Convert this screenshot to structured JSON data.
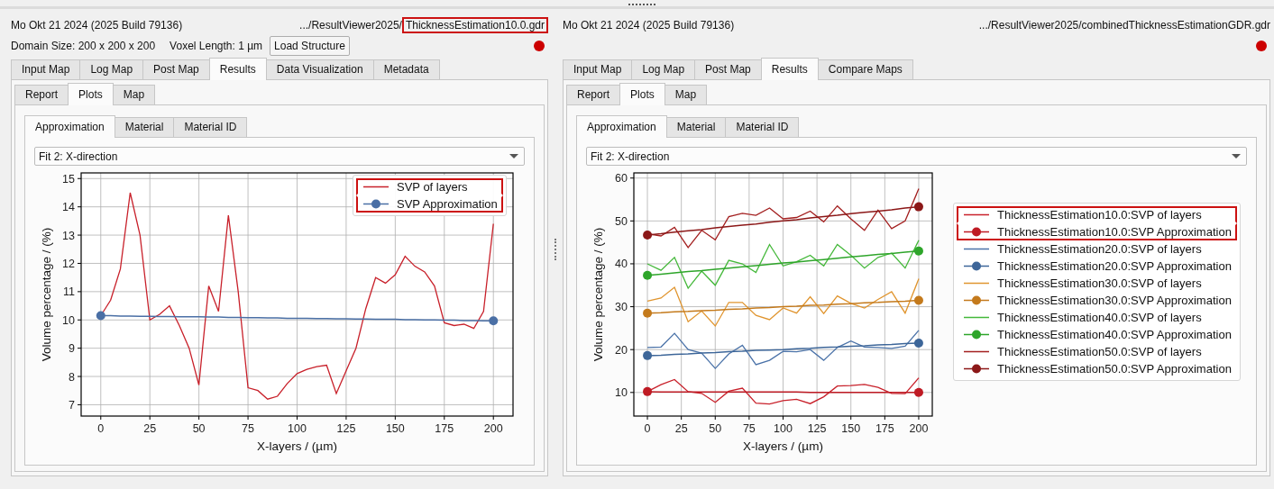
{
  "panes": [
    {
      "date": "Mo Okt 21 2024 (2025 Build 79136)",
      "path": ".../ResultViewer2025/",
      "file": "ThicknessEstimation10.0.gdr",
      "file_highlighted": true,
      "domain_size": "Domain Size: 200 x 200 x 200",
      "voxel_length": "Voxel Length: 1 µm",
      "load_button": "Load Structure",
      "tabs": [
        {
          "label": "Input Map",
          "selected": false
        },
        {
          "label": "Log Map",
          "selected": false
        },
        {
          "label": "Post Map",
          "selected": false
        },
        {
          "label": "Results",
          "selected": true
        },
        {
          "label": "Data Visualization",
          "selected": false
        },
        {
          "label": "Metadata",
          "selected": false
        }
      ],
      "subtabs": [
        {
          "label": "Report",
          "selected": false
        },
        {
          "label": "Plots",
          "selected": true
        },
        {
          "label": "Map",
          "selected": false
        }
      ],
      "plot_tabs": [
        {
          "label": "Approximation",
          "selected": true
        },
        {
          "label": "Material",
          "selected": false
        },
        {
          "label": "Material ID",
          "selected": false
        }
      ],
      "fit_select": "Fit 2: X-direction",
      "legend_entries": [
        {
          "highlighted": true,
          "marker": false
        },
        {
          "highlighted": true,
          "marker": true
        }
      ],
      "chart_data": {
        "type": "line",
        "xlabel": "X-layers / (µm)",
        "ylabel": "Volume percentage / (%)",
        "xlim": [
          -10,
          210
        ],
        "ylim": [
          6.6,
          15.2
        ],
        "xticks": [
          0,
          25,
          50,
          75,
          100,
          125,
          150,
          175,
          200
        ],
        "yticks": [
          7,
          8,
          9,
          10,
          11,
          12,
          13,
          14,
          15
        ],
        "grid": true,
        "legend": "upper right",
        "x": [
          0,
          5,
          10,
          15,
          20,
          25,
          30,
          35,
          40,
          45,
          50,
          55,
          60,
          65,
          70,
          75,
          80,
          85,
          90,
          95,
          100,
          105,
          110,
          115,
          120,
          125,
          130,
          135,
          140,
          145,
          150,
          155,
          160,
          165,
          170,
          175,
          180,
          185,
          190,
          195,
          200
        ],
        "series": [
          {
            "name": "SVP of layers",
            "color": "#c8202a",
            "values": [
              10.15,
              10.7,
              11.8,
              14.5,
              13.0,
              10.0,
              10.2,
              10.5,
              9.8,
              9.0,
              7.7,
              11.2,
              10.3,
              13.7,
              11.0,
              7.6,
              7.5,
              7.2,
              7.3,
              7.75,
              8.1,
              8.25,
              8.35,
              8.4,
              7.4,
              8.2,
              9.0,
              10.4,
              11.5,
              11.3,
              11.6,
              12.25,
              11.9,
              11.7,
              11.2,
              9.9,
              9.8,
              9.85,
              9.7,
              10.3,
              13.4
            ]
          },
          {
            "name": "SVP Approximation",
            "color": "#4a6fa5",
            "values": [
              10.15,
              10.15,
              10.14,
              10.14,
              10.13,
              10.13,
              10.12,
              10.12,
              10.11,
              10.11,
              10.11,
              10.1,
              10.1,
              10.09,
              10.09,
              10.08,
              10.08,
              10.07,
              10.07,
              10.06,
              10.06,
              10.06,
              10.05,
              10.05,
              10.04,
              10.04,
              10.03,
              10.03,
              10.02,
              10.02,
              10.02,
              10.01,
              10.01,
              10.0,
              10.0,
              9.99,
              9.99,
              9.98,
              9.98,
              9.97,
              9.97
            ]
          }
        ]
      }
    },
    {
      "date": "Mo Okt 21 2024 (2025 Build 79136)",
      "path": ".../ResultViewer2025/",
      "file": "combinedThicknessEstimationGDR.gdr",
      "file_highlighted": false,
      "tabs": [
        {
          "label": "Input Map",
          "selected": false
        },
        {
          "label": "Log Map",
          "selected": false
        },
        {
          "label": "Post Map",
          "selected": false
        },
        {
          "label": "Results",
          "selected": true
        },
        {
          "label": "Compare Maps",
          "selected": false
        }
      ],
      "subtabs": [
        {
          "label": "Report",
          "selected": false
        },
        {
          "label": "Plots",
          "selected": true
        },
        {
          "label": "Map",
          "selected": false
        }
      ],
      "plot_tabs": [
        {
          "label": "Approximation",
          "selected": true
        },
        {
          "label": "Material",
          "selected": false
        },
        {
          "label": "Material ID",
          "selected": false
        }
      ],
      "fit_select": "Fit 2: X-direction",
      "legend_entries": [
        {
          "highlighted": true,
          "marker": false
        },
        {
          "highlighted": true,
          "marker": true
        },
        {
          "highlighted": false,
          "marker": false
        },
        {
          "highlighted": false,
          "marker": true
        },
        {
          "highlighted": false,
          "marker": false
        },
        {
          "highlighted": false,
          "marker": true
        },
        {
          "highlighted": false,
          "marker": false
        },
        {
          "highlighted": false,
          "marker": true
        },
        {
          "highlighted": false,
          "marker": false
        },
        {
          "highlighted": false,
          "marker": true
        }
      ],
      "chart_data": {
        "type": "line",
        "xlabel": "X-layers / (µm)",
        "ylabel": "Volume percentage / (%)",
        "xlim": [
          -10,
          210
        ],
        "ylim": [
          4.5,
          61.2
        ],
        "xticks": [
          0,
          25,
          50,
          75,
          100,
          125,
          150,
          175,
          200
        ],
        "yticks": [
          10,
          20,
          30,
          40,
          50,
          60
        ],
        "grid": true,
        "legend": "outside right",
        "x": [
          0,
          10,
          20,
          30,
          40,
          50,
          60,
          70,
          80,
          90,
          100,
          110,
          120,
          130,
          140,
          150,
          160,
          170,
          180,
          190,
          200
        ],
        "series": [
          {
            "name": "ThicknessEstimation10.0:SVP of layers",
            "color": "#c8202a",
            "values": [
              10.2,
              11.8,
              13.0,
              10.2,
              9.8,
              7.7,
              10.3,
              11.0,
              7.5,
              7.3,
              8.1,
              8.4,
              7.4,
              9.0,
              11.5,
              11.6,
              11.9,
              11.2,
              9.8,
              9.7,
              13.4
            ]
          },
          {
            "name": "ThicknessEstimation10.0:SVP Approximation",
            "color": "#bf1b24",
            "values": [
              10.2,
              10.1,
              10.1,
              10.1,
              10.1,
              10.1,
              10.1,
              10.1,
              10.1,
              10.1,
              10.1,
              10.1,
              10.0,
              10.0,
              10.0,
              10.0,
              10.0,
              10.0,
              10.0,
              10.0,
              10.0
            ]
          },
          {
            "name": "ThicknessEstimation20.0:SVP of layers",
            "color": "#4a72a8",
            "values": [
              20.5,
              20.6,
              23.8,
              20,
              19.2,
              15.6,
              19,
              21,
              16.5,
              17.5,
              19.6,
              19.5,
              20,
              17.5,
              20.5,
              22,
              20.6,
              20.5,
              20.3,
              20.8,
              24.5
            ]
          },
          {
            "name": "ThicknessEstimation20.0:SVP Approximation",
            "color": "#3d6699",
            "values": [
              18.6,
              18.7,
              18.9,
              19.0,
              19.2,
              19.3,
              19.5,
              19.6,
              19.8,
              19.9,
              20.0,
              20.2,
              20.3,
              20.5,
              20.6,
              20.8,
              20.9,
              21.1,
              21.2,
              21.4,
              21.5
            ]
          },
          {
            "name": "ThicknessEstimation30.0:SVP of layers",
            "color": "#e0952f",
            "values": [
              31.3,
              32,
              34.5,
              26.5,
              29,
              25.5,
              31,
              31,
              28,
              27,
              29.7,
              28.5,
              32.3,
              28.4,
              32.5,
              30.8,
              29.7,
              31.7,
              33.5,
              28.5,
              36.5
            ]
          },
          {
            "name": "ThicknessEstimation30.0:SVP Approximation",
            "color": "#c47a1c",
            "values": [
              28.5,
              28.6,
              28.8,
              28.9,
              29.1,
              29.2,
              29.4,
              29.5,
              29.7,
              29.8,
              30,
              30.1,
              30.3,
              30.4,
              30.6,
              30.7,
              30.9,
              31.0,
              31.2,
              31.3,
              31.5
            ]
          },
          {
            "name": "ThicknessEstimation40.0:SVP of layers",
            "color": "#44b83a",
            "values": [
              40,
              38.5,
              41.5,
              34.3,
              38.3,
              35,
              40.8,
              40,
              38,
              44.5,
              39.5,
              40.5,
              42,
              39.5,
              44.5,
              42,
              39,
              41.5,
              42.5,
              39,
              45.5
            ]
          },
          {
            "name": "ThicknessEstimation40.0:SVP Approximation",
            "color": "#2ea52a",
            "values": [
              37.3,
              37.6,
              37.9,
              38.2,
              38.4,
              38.7,
              39.0,
              39.3,
              39.6,
              39.9,
              40.2,
              40.4,
              40.7,
              41.0,
              41.3,
              41.6,
              41.9,
              42.2,
              42.4,
              42.7,
              43
            ]
          },
          {
            "name": "ThicknessEstimation50.0:SVP of layers",
            "color": "#a31f1f",
            "values": [
              47,
              46.5,
              48.5,
              43.8,
              47.8,
              45.6,
              51,
              51.8,
              51.3,
              53,
              50.5,
              50.8,
              52.3,
              49.8,
              53.5,
              50.5,
              47.8,
              52.5,
              48.2,
              50,
              57.5
            ]
          },
          {
            "name": "ThicknessEstimation50.0:SVP Approximation",
            "color": "#8c1818",
            "values": [
              46.7,
              47.0,
              47.4,
              47.7,
              48.0,
              48.4,
              48.7,
              49.0,
              49.3,
              49.7,
              50,
              50.3,
              50.7,
              51.0,
              51.3,
              51.7,
              52.0,
              52.3,
              52.6,
              53.0,
              53.3
            ]
          }
        ]
      }
    }
  ]
}
